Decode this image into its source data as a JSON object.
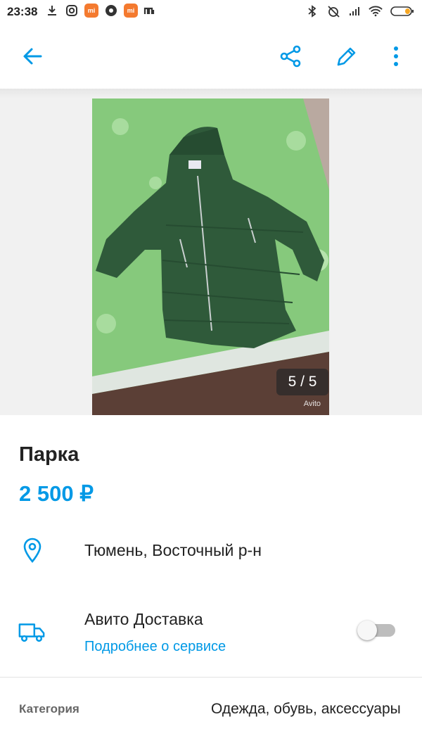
{
  "status_bar": {
    "time": "23:38",
    "left_icons": [
      "download-icon",
      "instagram-icon",
      "mi-app-icon",
      "vpn-icon",
      "mi-app-icon",
      "mi-icon"
    ],
    "right_icons": [
      "bluetooth-icon",
      "alarm-off-icon",
      "signal-icon",
      "wifi-icon",
      "battery-icon"
    ],
    "app_badge_label": "mi"
  },
  "toolbar": {
    "back_icon": "arrow-left-icon",
    "share_icon": "share-icon",
    "edit_icon": "pencil-icon",
    "more_icon": "more-vertical-icon",
    "accent_color": "#0099e6"
  },
  "gallery": {
    "counter": "5 / 5",
    "watermark": "Avito"
  },
  "listing": {
    "title": "Парка",
    "price": "2 500 ₽"
  },
  "location": {
    "icon": "location-pin-icon",
    "text": "Тюмень, Восточный р-н"
  },
  "delivery": {
    "icon": "truck-icon",
    "title": "Авито Доставка",
    "link": "Подробнее о сервисе",
    "enabled": false
  },
  "details": {
    "category_label": "Категория",
    "category_value": "Одежда, обувь, аксессуары"
  }
}
